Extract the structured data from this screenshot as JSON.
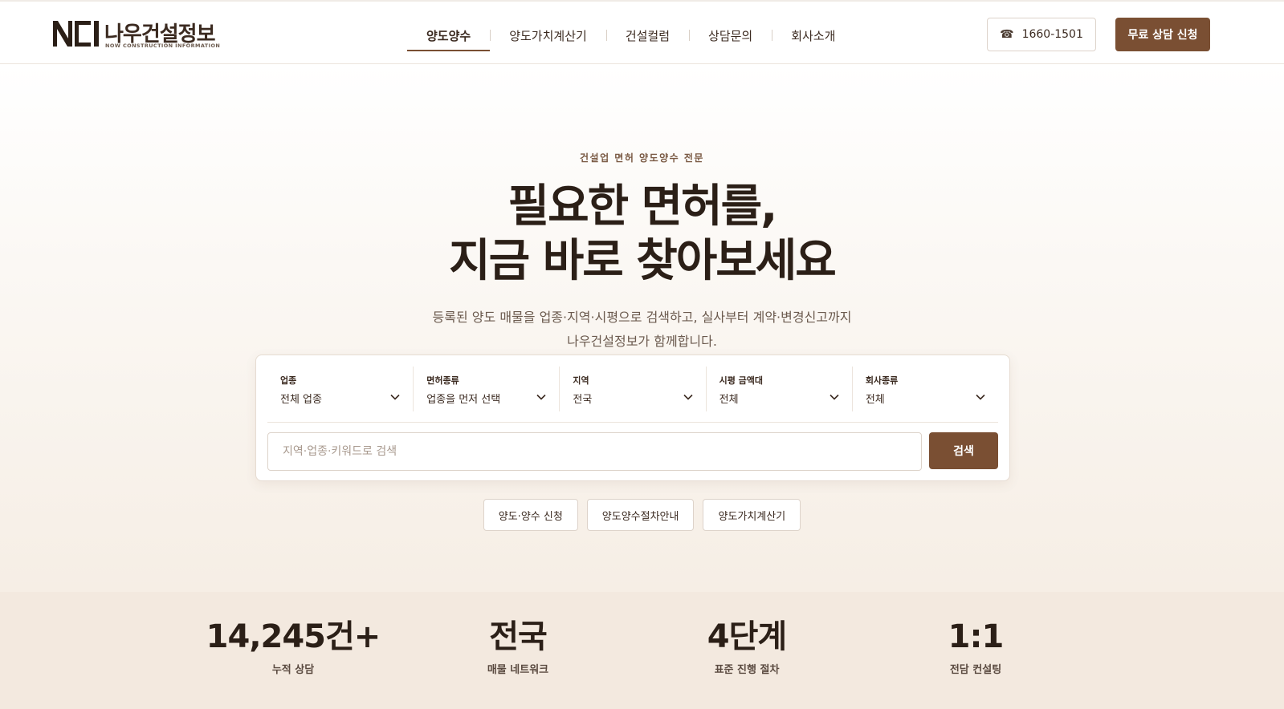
{
  "header": {
    "logo": {
      "mark": "NCI",
      "name": "나우건설정보",
      "sub": "NOW CONSTRUCTION INFORMATION"
    },
    "nav": [
      {
        "label": "양도양수",
        "active": true
      },
      {
        "label": "양도가치계산기",
        "active": false
      },
      {
        "label": "건설컬럼",
        "active": false
      },
      {
        "label": "상담문의",
        "active": false
      },
      {
        "label": "회사소개",
        "active": false
      }
    ],
    "phone": {
      "icon": "phone-icon",
      "label": "1660-1501"
    },
    "cta_label": "무료 상담 신청"
  },
  "hero": {
    "eyebrow": "건설업 면허 양도양수 전문",
    "title_line1": "필요한 면허를,",
    "title_line2": "지금 바로 찾아보세요",
    "desc_line1": "등록된 양도 매물을 업종·지역·시평으로 검색하고, 실사부터 계약·변경신고까지",
    "desc_line2": "나우건설정보가 함께합니다."
  },
  "search": {
    "filters": [
      {
        "label": "업종",
        "value": "전체 업종"
      },
      {
        "label": "면허종류",
        "value": "업종을 먼저 선택"
      },
      {
        "label": "지역",
        "value": "전국"
      },
      {
        "label": "시평 금액대",
        "value": "전체"
      },
      {
        "label": "회사종류",
        "value": "전체"
      }
    ],
    "placeholder": "지역·업종·키워드로 검색",
    "button_label": "검색"
  },
  "quick_links": [
    "양도·양수 신청",
    "양도양수절차안내",
    "양도가치계산기"
  ],
  "stats": [
    {
      "value": "14,245건+",
      "label": "누적 상담"
    },
    {
      "value": "전국",
      "label": "매물 네트워크"
    },
    {
      "value": "4단계",
      "label": "표준 진행 절차"
    },
    {
      "value": "1:1",
      "label": "전담 컨설팅"
    }
  ],
  "colors": {
    "accent": "#7a4f33",
    "text": "#2b1f17",
    "stats_bg": "#f3e9df"
  }
}
